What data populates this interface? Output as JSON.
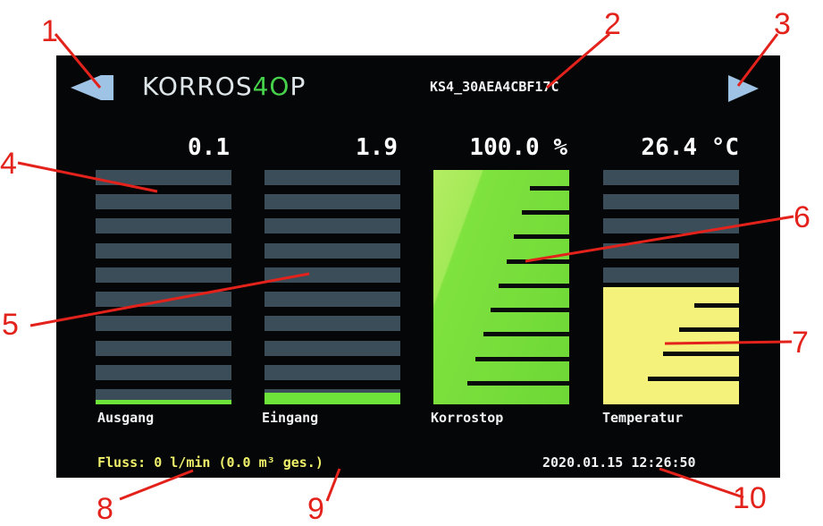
{
  "header": {
    "logo": {
      "left": "KORROS",
      "mid": "4O",
      "right": "P"
    },
    "device_id": "KS4_30AEA4CBF17C",
    "prev_icon": "triangle-left-icon",
    "next_icon": "triangle-right-icon"
  },
  "gauges": [
    {
      "id": "ausgang",
      "label": "Ausgang",
      "value": "0.1",
      "fill_fraction": 0.02,
      "color": "#6ee33a"
    },
    {
      "id": "eingang",
      "label": "Eingang",
      "value": "1.9",
      "fill_fraction": 0.05,
      "color": "#6ee33a"
    },
    {
      "id": "korrostop",
      "label": "Korrostop",
      "value": "100.0 %",
      "fill_fraction": 1.0,
      "color": "#8fe84a"
    },
    {
      "id": "temperatur",
      "label": "Temperatur",
      "value": "26.4 °C",
      "fill_fraction": 0.5,
      "color": "#f4f27a"
    }
  ],
  "footer": {
    "flow": "Fluss:  0 l/min (0.0 m³ ges.)",
    "datetime": "2020.01.15 12:26:50"
  },
  "callouts": [
    "1",
    "2",
    "3",
    "4",
    "5",
    "6",
    "7",
    "8",
    "9",
    "10"
  ],
  "colors": {
    "screen_bg": "#050608",
    "segment_empty": "#3c4d5a",
    "annotation_red": "#e3221b",
    "arrow_blue": "#9fc3e4"
  }
}
